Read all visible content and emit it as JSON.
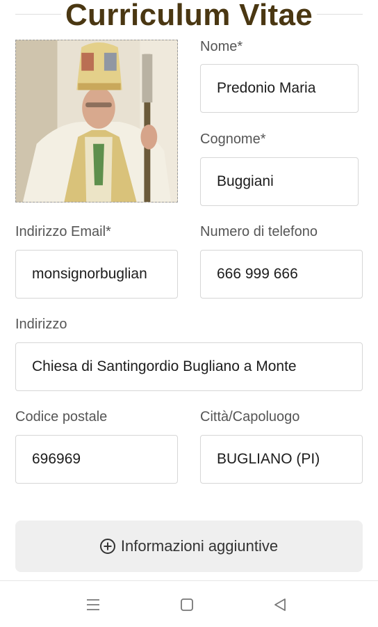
{
  "title": "Curriculum Vitae",
  "photo": {
    "alt": "profile-photo"
  },
  "fields": {
    "nome": {
      "label": "Nome*",
      "value": "Predonio Maria"
    },
    "cognome": {
      "label": "Cognome*",
      "value": "Buggiani"
    },
    "email": {
      "label": "Indirizzo Email*",
      "value": "monsignorbuglian"
    },
    "telefono": {
      "label": "Numero di telefono",
      "value": "666 999 666"
    },
    "indirizzo": {
      "label": "Indirizzo",
      "value": "Chiesa di Santingordio Bugliano a Monte"
    },
    "cap": {
      "label": "Codice postale",
      "value": "696969"
    },
    "citta": {
      "label": "Città/Capoluogo",
      "value": "BUGLIANO (PI)"
    }
  },
  "more_button": {
    "label": "Informazioni aggiuntive",
    "icon": "plus-circle-icon"
  },
  "navbar": {
    "icons": [
      "menu-icon",
      "home-icon",
      "back-icon"
    ]
  },
  "colors": {
    "title": "#4a3712",
    "field_border": "#d6d6d6",
    "button_bg": "#efefef"
  }
}
